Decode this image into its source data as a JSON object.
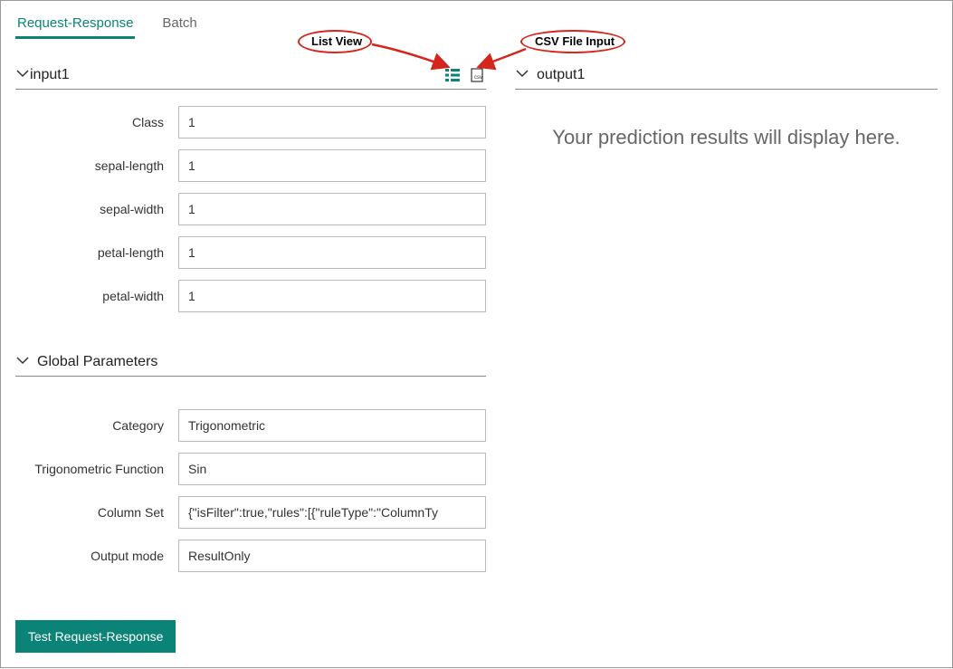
{
  "tabs": {
    "request_response": "Request-Response",
    "batch": "Batch"
  },
  "input1": {
    "title": "input1",
    "fields": [
      {
        "label": "Class",
        "value": "1"
      },
      {
        "label": "sepal-length",
        "value": "1"
      },
      {
        "label": "sepal-width",
        "value": "1"
      },
      {
        "label": "petal-length",
        "value": "1"
      },
      {
        "label": "petal-width",
        "value": "1"
      }
    ]
  },
  "global_parameters": {
    "title": "Global Parameters",
    "fields": [
      {
        "label": "Category",
        "value": "Trigonometric"
      },
      {
        "label": "Trigonometric Function",
        "value": "Sin"
      },
      {
        "label": "Column Set",
        "value": "{\"isFilter\":true,\"rules\":[{\"ruleType\":\"ColumnTy"
      },
      {
        "label": "Output mode",
        "value": "ResultOnly"
      }
    ]
  },
  "output1": {
    "title": "output1",
    "placeholder": "Your prediction results will display here."
  },
  "buttons": {
    "test": "Test Request-Response"
  },
  "annotations": {
    "list_view": "List View",
    "csv_file_input": "CSV File Input"
  },
  "icons": {
    "list_view_color": "#0b8376",
    "csv_color": "#333"
  }
}
